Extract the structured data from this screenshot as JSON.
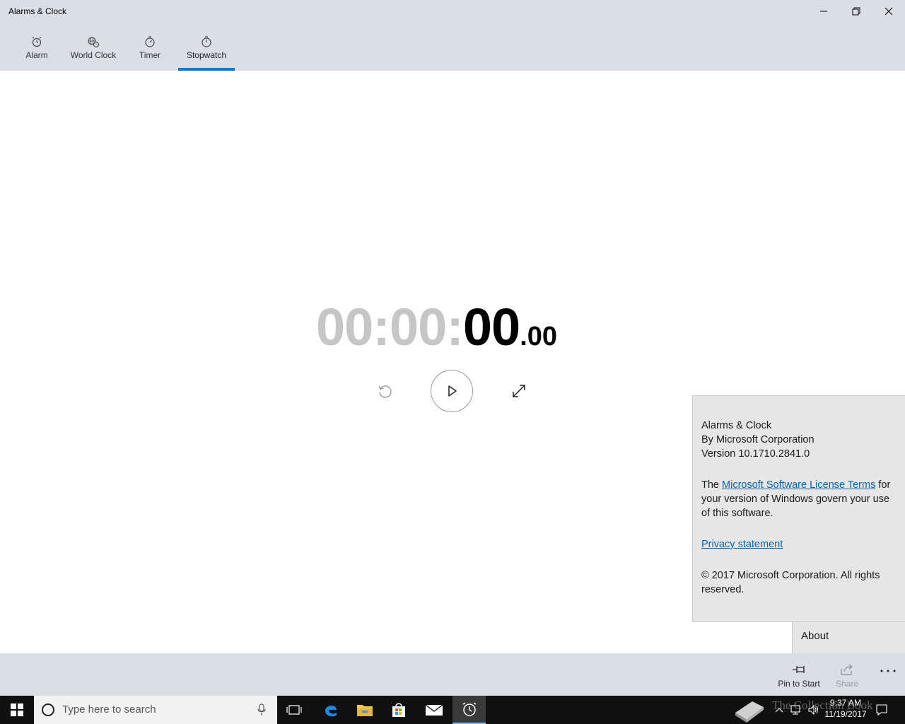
{
  "window": {
    "title": "Alarms & Clock"
  },
  "nav": {
    "tabs": [
      {
        "label": "Alarm",
        "icon": "alarm-clock-icon"
      },
      {
        "label": "World Clock",
        "icon": "world-clock-icon"
      },
      {
        "label": "Timer",
        "icon": "timer-icon"
      },
      {
        "label": "Stopwatch",
        "icon": "stopwatch-icon"
      }
    ],
    "active_tab": "Stopwatch",
    "accent_color": "#0078d7"
  },
  "stopwatch": {
    "hours": "00:",
    "minutes": "00:",
    "seconds": "00",
    "fraction": ".00",
    "controls": [
      "reset-icon",
      "play-icon",
      "expand-icon"
    ]
  },
  "about": {
    "app_name": "Alarms & Clock",
    "publisher": "By Microsoft Corporation",
    "version": "Version 10.1710.2841.0",
    "license_prefix": "The ",
    "license_link": "Microsoft Software License Terms",
    "license_suffix": " for your version of Windows govern your use of this software.",
    "privacy_link": "Privacy statement",
    "copyright": "© 2017 Microsoft Corporation. All rights reserved.",
    "menu_item": "About"
  },
  "command_bar": {
    "pin_label": "Pin to Start",
    "share_label": "Share"
  },
  "taskbar": {
    "search_placeholder": "Type here to search",
    "time": "9:37 AM",
    "date": "11/19/2017",
    "watermark": "The Collection Book"
  }
}
